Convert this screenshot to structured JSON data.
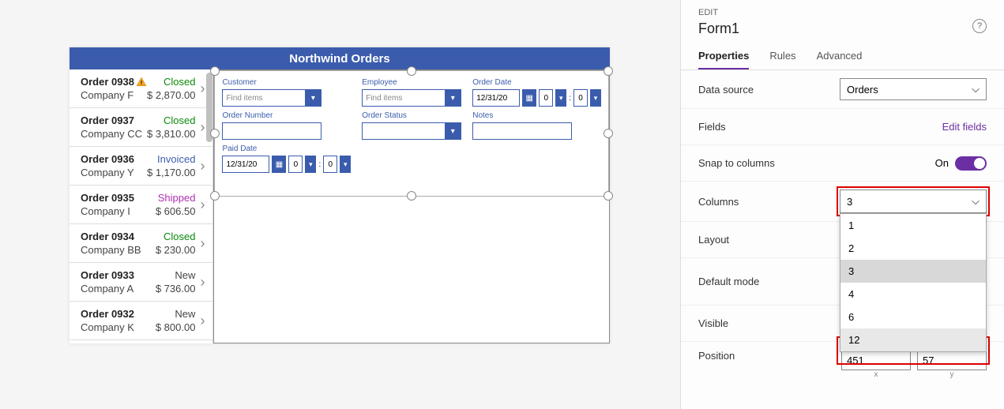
{
  "title": "Northwind Orders",
  "orders": [
    {
      "num": "Order 0938",
      "status": "Closed",
      "statusClass": "st-closed",
      "company": "Company F",
      "amount": "$ 2,870.00",
      "warn": true
    },
    {
      "num": "Order 0937",
      "status": "Closed",
      "statusClass": "st-closed",
      "company": "Company CC",
      "amount": "$ 3,810.00"
    },
    {
      "num": "Order 0936",
      "status": "Invoiced",
      "statusClass": "st-invoiced",
      "company": "Company Y",
      "amount": "$ 1,170.00"
    },
    {
      "num": "Order 0935",
      "status": "Shipped",
      "statusClass": "st-shipped",
      "company": "Company I",
      "amount": "$ 606.50"
    },
    {
      "num": "Order 0934",
      "status": "Closed",
      "statusClass": "st-closed",
      "company": "Company BB",
      "amount": "$ 230.00"
    },
    {
      "num": "Order 0933",
      "status": "New",
      "statusClass": "st-new",
      "company": "Company A",
      "amount": "$ 736.00"
    },
    {
      "num": "Order 0932",
      "status": "New",
      "statusClass": "st-new",
      "company": "Company K",
      "amount": "$ 800.00"
    }
  ],
  "form": {
    "fields": {
      "customer": {
        "label": "Customer",
        "placeholder": "Find items"
      },
      "employee": {
        "label": "Employee",
        "placeholder": "Find items"
      },
      "orderDate": {
        "label": "Order Date",
        "value": "12/31/20",
        "spin": "0"
      },
      "orderNumber": {
        "label": "Order Number"
      },
      "orderStatus": {
        "label": "Order Status"
      },
      "notes": {
        "label": "Notes"
      },
      "paidDate": {
        "label": "Paid Date",
        "value": "12/31/20",
        "spin": "0"
      }
    }
  },
  "panel": {
    "editLabel": "EDIT",
    "name": "Form1",
    "tabs": {
      "properties": "Properties",
      "rules": "Rules",
      "advanced": "Advanced"
    },
    "dataSource": {
      "label": "Data source",
      "value": "Orders"
    },
    "fields": {
      "label": "Fields",
      "link": "Edit fields"
    },
    "snap": {
      "label": "Snap to columns",
      "value": "On"
    },
    "columns": {
      "label": "Columns",
      "value": "3",
      "options": [
        "1",
        "2",
        "3",
        "4",
        "6",
        "12"
      ]
    },
    "layout": {
      "label": "Layout"
    },
    "defaultMode": {
      "label": "Default mode"
    },
    "visible": {
      "label": "Visible"
    },
    "position": {
      "label": "Position",
      "x": "451",
      "y": "57",
      "xlabel": "x",
      "ylabel": "y"
    }
  }
}
